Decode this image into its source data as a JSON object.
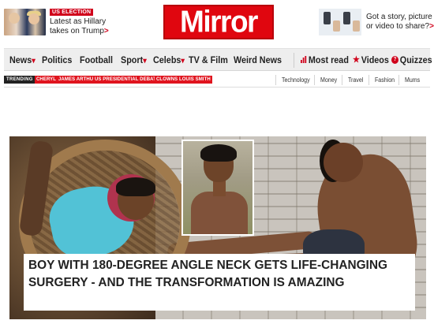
{
  "promo": {
    "badge": "US ELECTION",
    "text": "Latest as Hillary takes on Trump",
    "chevron": ">"
  },
  "logo": {
    "text": "Mirror",
    "color": "#e0060f"
  },
  "story_prompt": {
    "text": "Got a story, picture or video to share?",
    "chevron": ">"
  },
  "nav": {
    "items": [
      {
        "label": "News",
        "dropdown": "▾"
      },
      {
        "label": "Politics"
      },
      {
        "label": "Football"
      },
      {
        "label": "Sport",
        "dropdown": "▾"
      },
      {
        "label": "Celebs",
        "dropdown": "▾"
      },
      {
        "label": "TV & Film"
      },
      {
        "label": "Weird News"
      },
      {
        "label": "Most read",
        "icon": "bar-chart-icon"
      },
      {
        "label": "Videos",
        "icon": "star-icon"
      },
      {
        "label": "Quizzes",
        "icon": "question-icon"
      }
    ]
  },
  "trending": {
    "label": "TRENDING",
    "tags": [
      "CHERYL",
      "JAMES ARTHUR",
      "US PRESIDENTIAL DEBATE",
      "CLOWNS",
      "LOUIS SMITH"
    ],
    "sections": [
      "Technology",
      "Money",
      "Travel",
      "Fashion",
      "Mums"
    ]
  },
  "hero": {
    "headline": "BOY WITH 180-DEGREE ANGLE NECK GETS LIFE-CHANGING SURGERY - AND THE TRANSFORMATION IS AMAZING"
  },
  "colors": {
    "accent": "#d0021b",
    "nav_bg": "#eeeeee"
  }
}
